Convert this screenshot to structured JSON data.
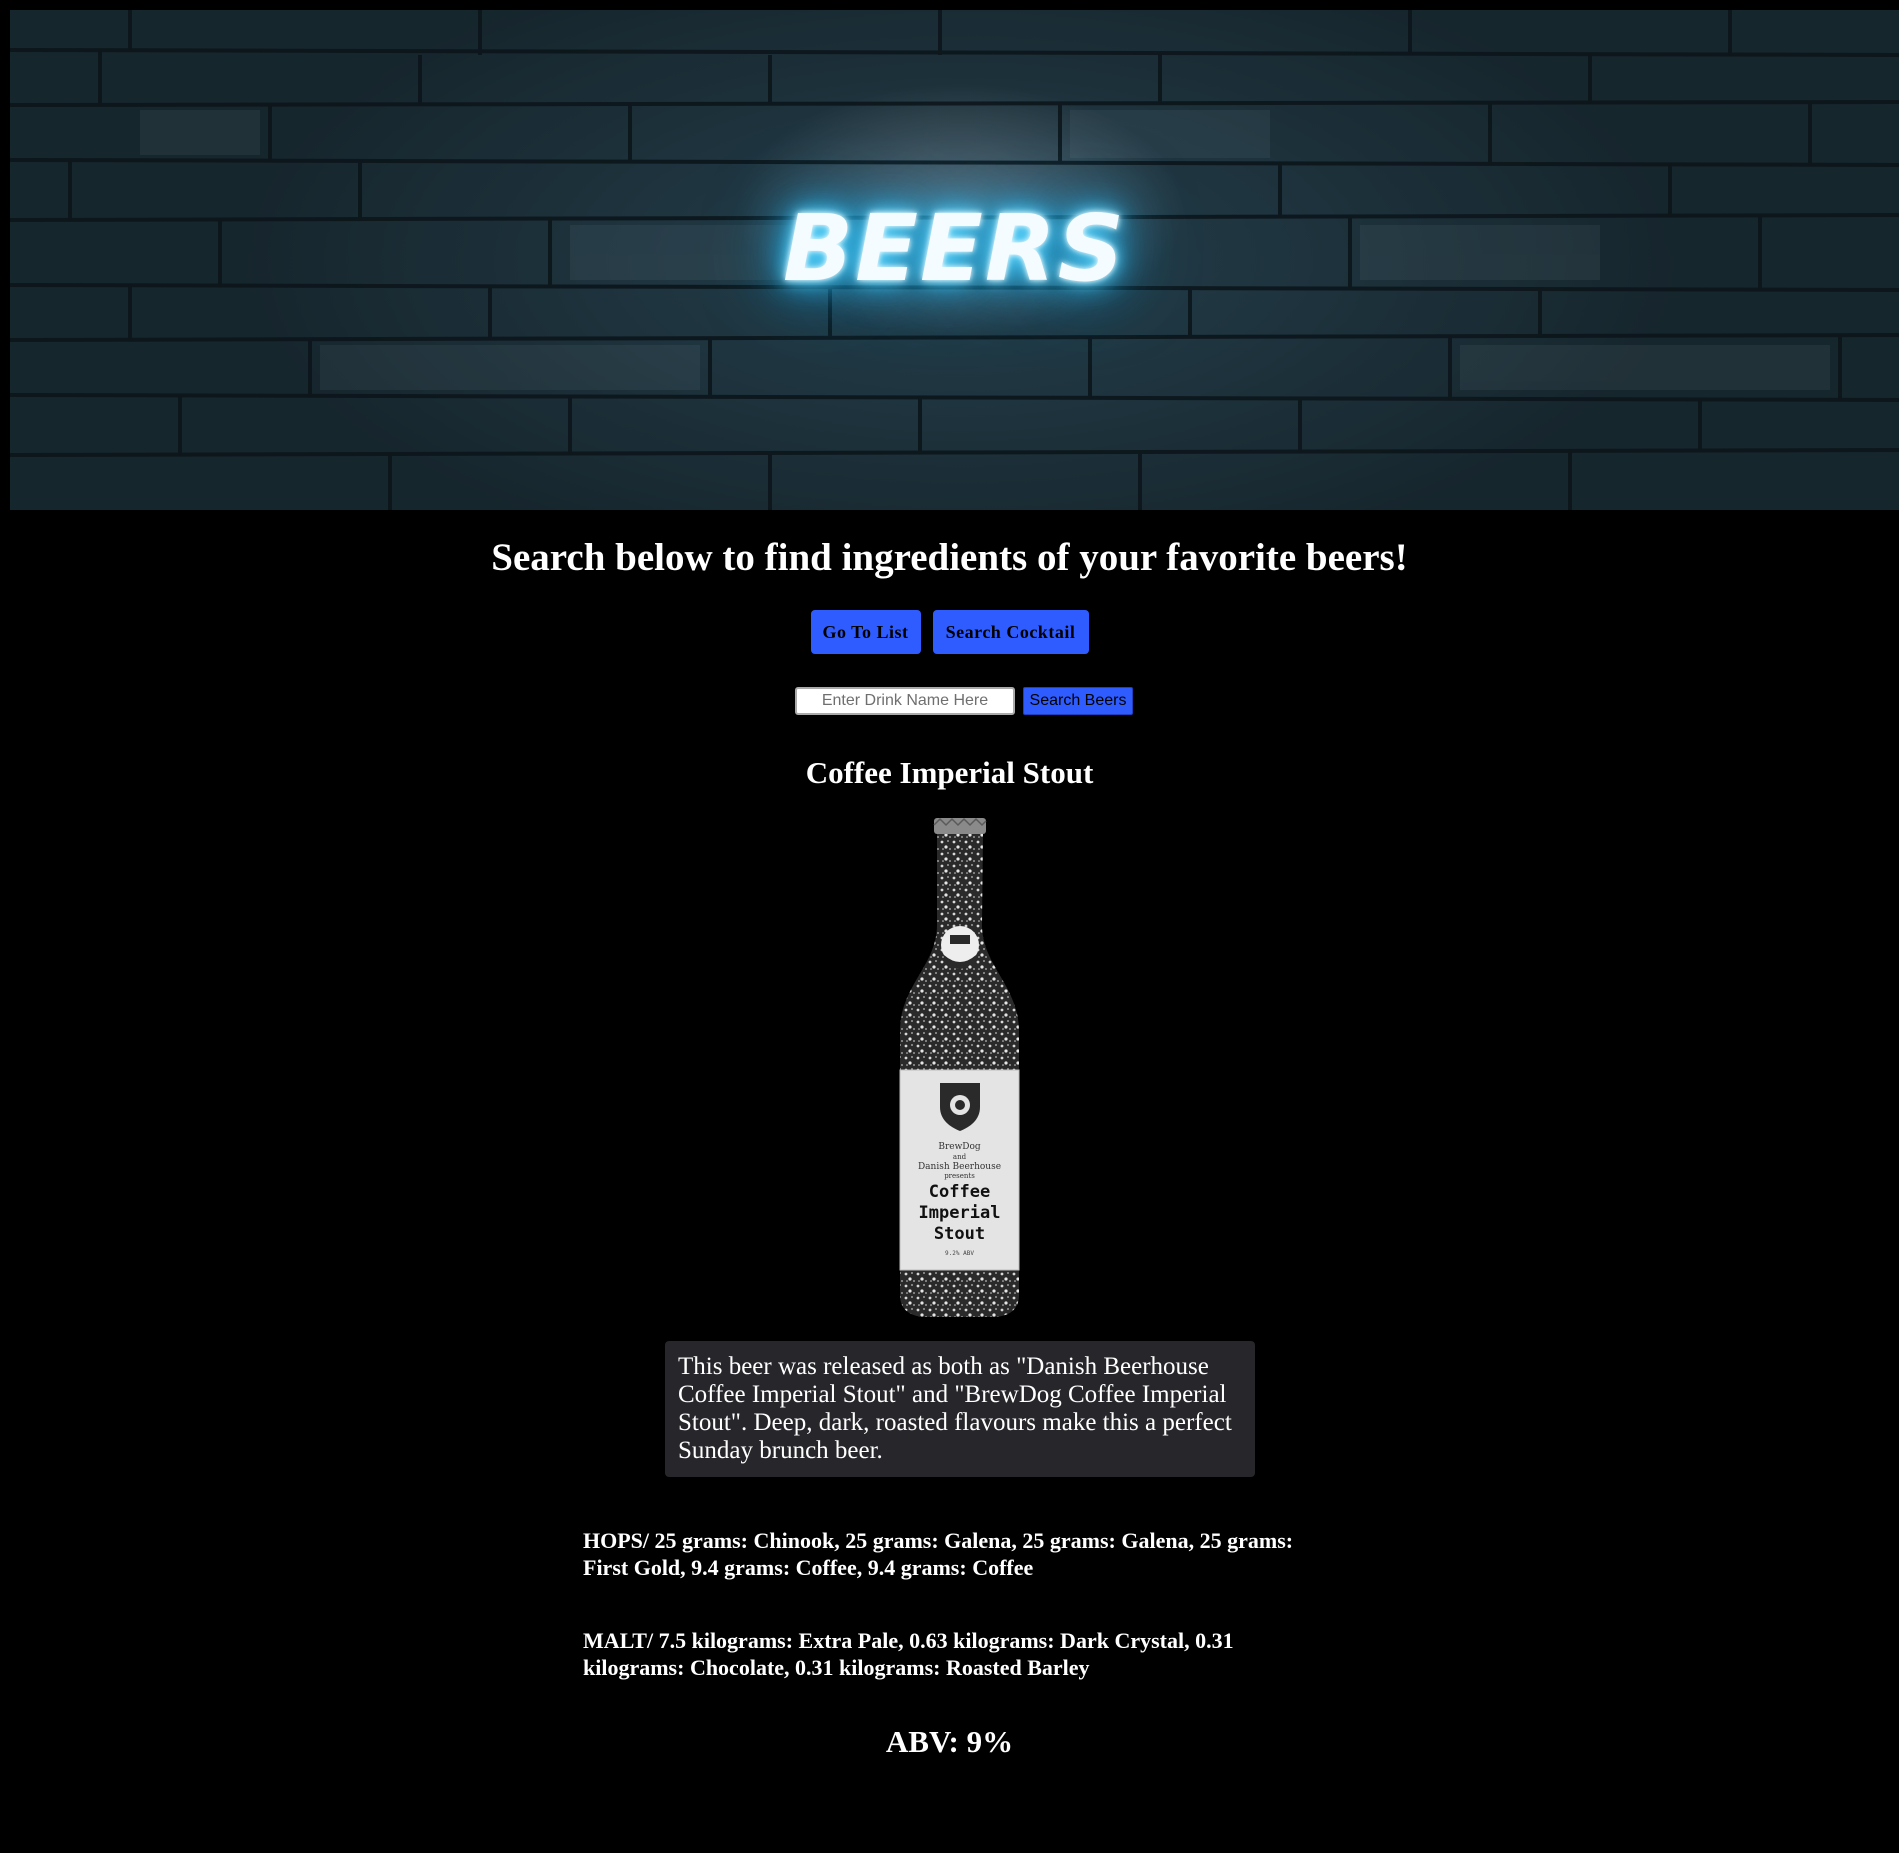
{
  "header": {
    "banner_title": "BEERS"
  },
  "main": {
    "heading": "Search below to find ingredients of your favorite beers!",
    "buttons": {
      "go_to_list": "Go To List",
      "search_cocktail": "Search Cocktail"
    },
    "search": {
      "placeholder": "Enter Drink Name Here",
      "value": "",
      "button_label": "Search Beers"
    }
  },
  "beer": {
    "name": "Coffee Imperial Stout",
    "label": {
      "line1": "BrewDog",
      "line2": "and",
      "line3": "Danish Beerhouse",
      "line4": "presents",
      "name_line1": "Coffee",
      "name_line2": "Imperial",
      "name_line3": "Stout",
      "abv_text": "9.2% ABV"
    },
    "description": "This beer was released as both as \"Danish Beerhouse Coffee Imperial Stout\" and \"BrewDog Coffee Imperial Stout\". Deep, dark, roasted flavours make this a perfect Sunday brunch beer.",
    "hops": "HOPS/ 25 grams: Chinook, 25 grams: Galena, 25 grams: Galena, 25 grams: First Gold, 9.4 grams: Coffee, 9.4 grams: Coffee",
    "malt": "MALT/ 7.5 kilograms: Extra Pale, 0.63 kilograms: Dark Crystal, 0.31 kilograms: Chocolate, 0.31 kilograms: Roasted Barley",
    "abv": "ABV: 9%"
  },
  "colors": {
    "background": "#000000",
    "button": "#2f5cff",
    "description_bg": "#26262b",
    "neon_glow": "#2fc6ff"
  }
}
